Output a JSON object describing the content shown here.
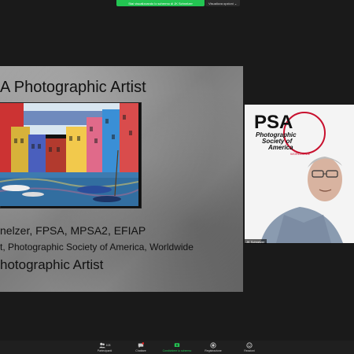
{
  "banner": {
    "sharing_text": "Stai visualizzando lo schermo di JK Schnelzer",
    "view_options": "Visualizza opzioni ⌄"
  },
  "slide": {
    "title": "A Photographic Artist",
    "line1": "nelzer, FPSA, MPSA2, EFIAP",
    "line2": "t, Photographic Society of America, Worldwide",
    "line3": "hotographic Artist"
  },
  "video": {
    "logo_main": "PSA",
    "logo_sub1": "Photographic",
    "logo_sub2": "Society of",
    "logo_sub3": "America",
    "logo_sub4": "WORLDWIDE",
    "speaker_name": "JK Schnelzer"
  },
  "toolbar": {
    "participants_label": "Partecipanti",
    "participants_count": "108",
    "chat_label": "Chattare",
    "share_label": "Condividere lo schermo",
    "record_label": "Registrazione",
    "reactions_label": "Reazioni"
  },
  "colors": {
    "accent": "#23c552",
    "psa_red": "#c8102e"
  }
}
